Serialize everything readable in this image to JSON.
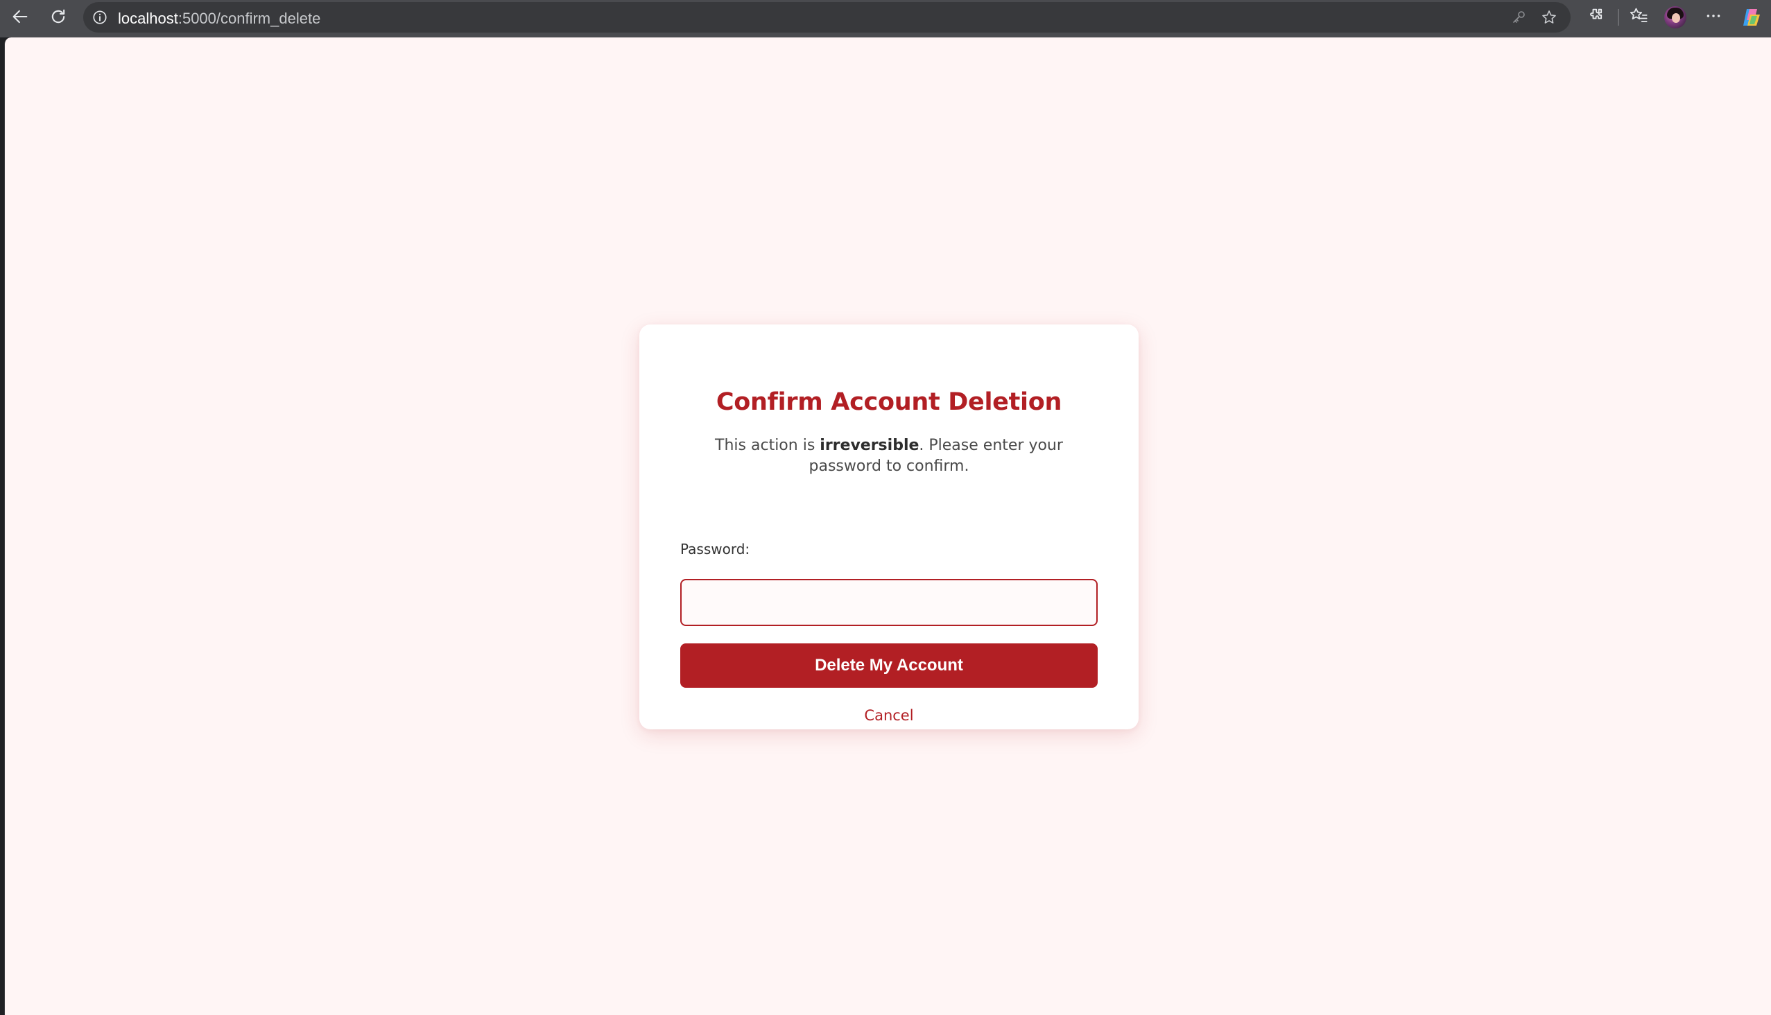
{
  "browser": {
    "url_host": "localhost",
    "url_path": ":5000/confirm_delete",
    "icons": [
      "back-arrow-icon",
      "reload-icon",
      "info-icon",
      "key-icon",
      "star-icon",
      "extensions-icon",
      "favorites-icon",
      "profile-avatar",
      "more-icon",
      "copilot-icon"
    ]
  },
  "page": {
    "background": "#fff5f5",
    "accent_color": "#b21f24",
    "title": "Confirm Account Deletion",
    "desc_before": "This action is ",
    "desc_bold": "irreversible",
    "desc_after": ". Please enter your password to confirm.",
    "password_label": "Password:",
    "password_value": "",
    "delete_button_label": "Delete My Account",
    "cancel_label": "Cancel"
  }
}
